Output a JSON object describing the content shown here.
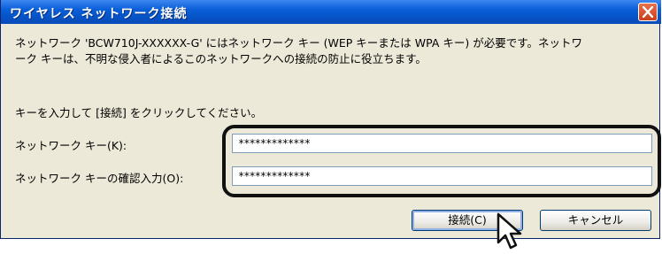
{
  "window": {
    "title": "ワイヤレス ネットワーク接続",
    "close_icon": "close-icon"
  },
  "message": {
    "line1": "ネットワーク 'BCW710J-XXXXXX-G' にはネットワーク キー (WEP キーまたは WPA キー) が必要です。ネットワ",
    "line2": "ーク キーは、不明な侵入者によるこのネットワークへの接続の防止に役立ちます。"
  },
  "instruction": "キーを入力して [接続] をクリックしてください。",
  "fields": {
    "key_label": "ネットワーク キー(K):",
    "key_value": "*************",
    "confirm_label": "ネットワーク キーの確認入力(O):",
    "confirm_value": "*************"
  },
  "buttons": {
    "connect": "接続(C)",
    "cancel": "キャンセル"
  },
  "colors": {
    "titlebar": "#0a5fd8",
    "dialog_bg": "#ece9d8",
    "close_button": "#d3552f",
    "highlight": "#111111"
  }
}
